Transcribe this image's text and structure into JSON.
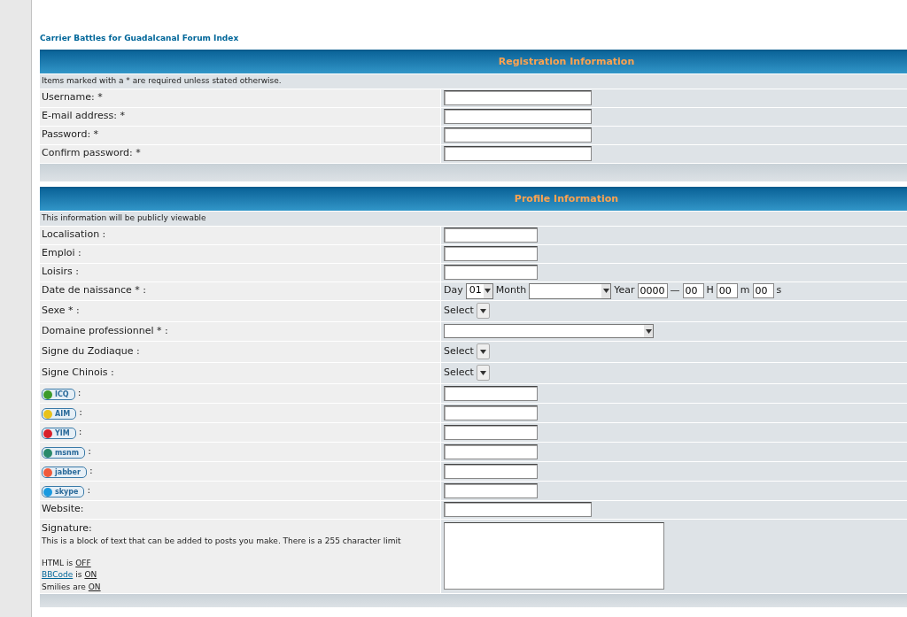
{
  "forum_link": "Carrier Battles for Guadalcanal Forum Index",
  "sections": [
    {
      "title": "Registration Information",
      "note": "Items marked with a * are required unless stated otherwise.",
      "rows": [
        {
          "kind": "text_long",
          "label": "Username: *"
        },
        {
          "kind": "text_long",
          "label": "E-mail address: *"
        },
        {
          "kind": "text_long",
          "label": "Password: *"
        },
        {
          "kind": "text_long",
          "label": "Confirm password: *"
        }
      ]
    },
    {
      "title": "Profile Information",
      "note": "This information will be publicly viewable",
      "rows": [
        {
          "kind": "text_short",
          "label": "Localisation :"
        },
        {
          "kind": "text_short",
          "label": "Emploi :"
        },
        {
          "kind": "text_short",
          "label": "Loisirs :"
        },
        {
          "kind": "date",
          "label": "Date de naissance * :",
          "parts": [
            {
              "kind": "label",
              "text": "Day"
            },
            {
              "kind": "select",
              "value": "01"
            },
            {
              "kind": "label",
              "text": "Month"
            },
            {
              "kind": "select_wide"
            },
            {
              "kind": "label",
              "text": "Year"
            },
            {
              "kind": "input",
              "value": "0000"
            },
            {
              "kind": "label",
              "text": "—"
            },
            {
              "kind": "input_small",
              "value": "00"
            },
            {
              "kind": "label",
              "text": "H"
            },
            {
              "kind": "input_small",
              "value": "00"
            },
            {
              "kind": "label",
              "text": "m"
            },
            {
              "kind": "input_small",
              "value": "00"
            },
            {
              "kind": "label",
              "text": "s"
            }
          ]
        },
        {
          "kind": "select_small",
          "label": "Sexe * :",
          "value": "Select"
        },
        {
          "kind": "dropdown_wide",
          "label": "Domaine professionnel * :"
        },
        {
          "kind": "select_small",
          "label": "Signe du Zodiaque :",
          "value": "Select"
        },
        {
          "kind": "select_small",
          "label": "Signe Chinois :",
          "value": "Select"
        },
        {
          "kind": "messenger",
          "badge": "ICQ",
          "color": "#3c9a2a",
          "label": ":"
        },
        {
          "kind": "messenger",
          "badge": "AIM",
          "color": "#e8c21a",
          "label": ":"
        },
        {
          "kind": "messenger",
          "badge": "YIM",
          "color": "#d8202a",
          "label": ":"
        },
        {
          "kind": "messenger",
          "badge": "msnm",
          "color": "#2a8a6a",
          "label": ":"
        },
        {
          "kind": "messenger",
          "badge": "jabber",
          "color": "#f05a3a",
          "label": ":"
        },
        {
          "kind": "messenger",
          "badge": "skype",
          "color": "#1a9ae0",
          "label": ":"
        },
        {
          "kind": "text_long",
          "label": "Website:"
        },
        {
          "kind": "textarea",
          "label": "Signature:",
          "description": "This is a block of text that can be added to posts you make. There is a 255 character limit",
          "status_lines": [
            {
              "subject": "HTML",
              "subject_is_link": false,
              "verb": "is",
              "value": "OFF"
            },
            {
              "subject": "BBCode",
              "subject_is_link": true,
              "verb": "is",
              "value": "ON"
            },
            {
              "subject": "Smilies",
              "subject_is_link": false,
              "verb": "are",
              "value": "ON"
            }
          ]
        }
      ]
    }
  ]
}
